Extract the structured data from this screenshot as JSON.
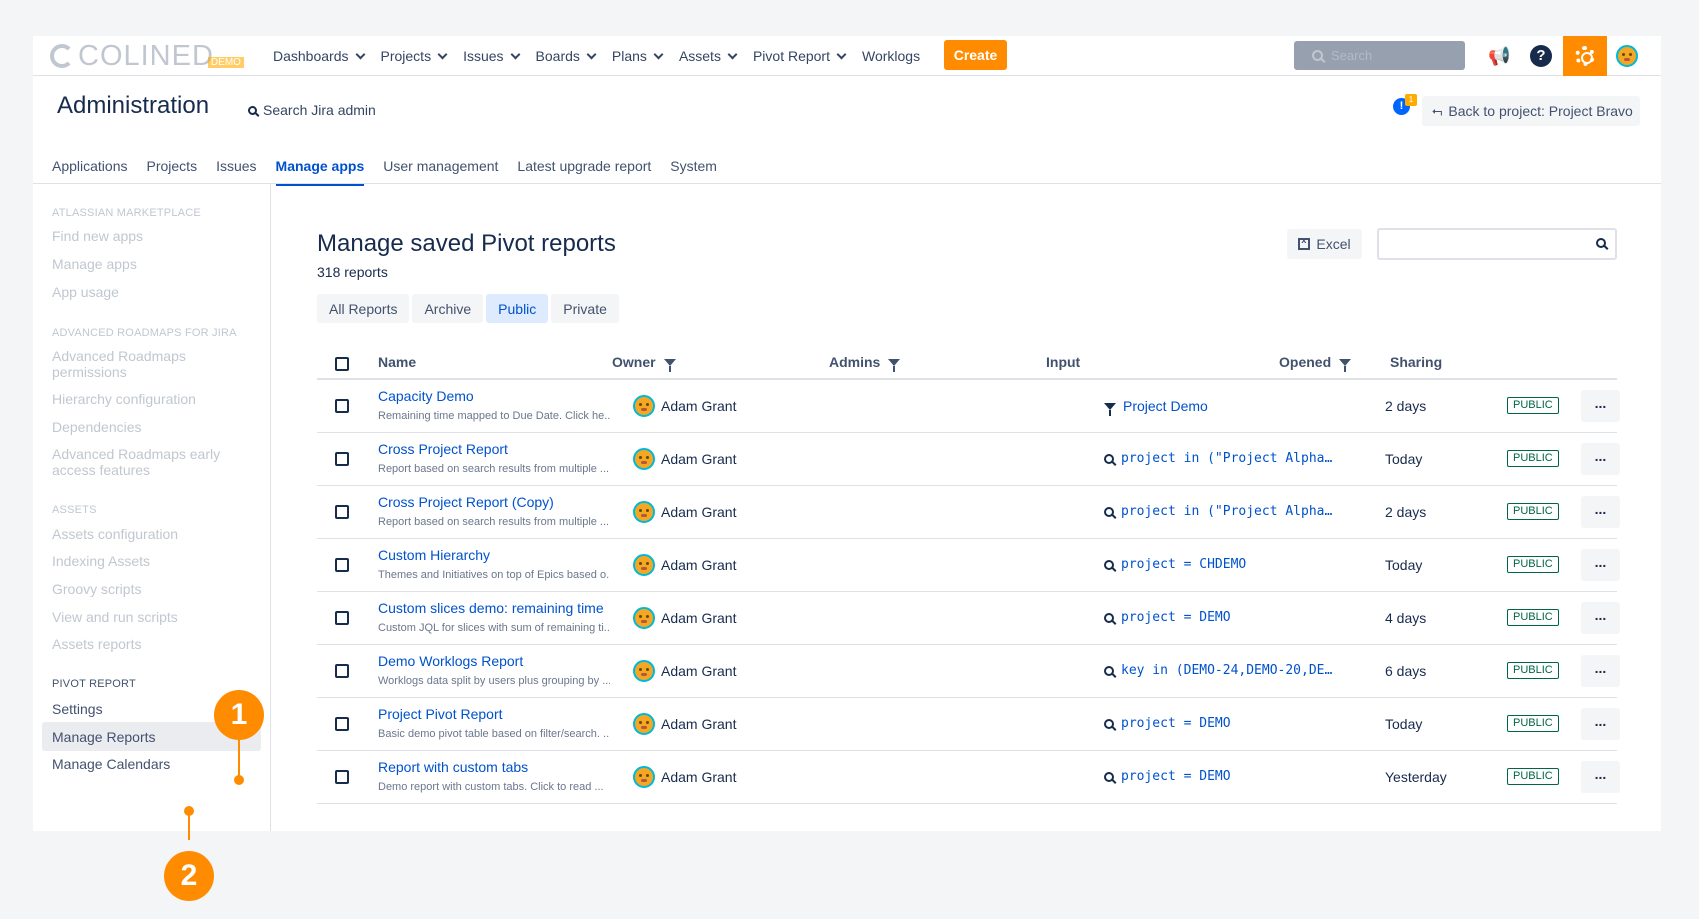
{
  "logo": {
    "text": "COLINED",
    "badge": "DEMO"
  },
  "topnav": {
    "items": [
      {
        "label": "Dashboards",
        "dropdown": true
      },
      {
        "label": "Projects",
        "dropdown": true
      },
      {
        "label": "Issues",
        "dropdown": true
      },
      {
        "label": "Boards",
        "dropdown": true
      },
      {
        "label": "Plans",
        "dropdown": true
      },
      {
        "label": "Assets",
        "dropdown": true
      },
      {
        "label": "Pivot Report",
        "dropdown": true
      },
      {
        "label": "Worklogs",
        "dropdown": false
      }
    ],
    "create_label": "Create",
    "search_placeholder": "Search",
    "help_glyph": "?",
    "megaphone_glyph": "📢"
  },
  "admin": {
    "title": "Administration",
    "search_label": "Search Jira admin",
    "notif_glyph": "!",
    "notif_count": "1",
    "back_label": "Back to project: Project Bravo"
  },
  "admin_tabs": [
    {
      "label": "Applications",
      "active": false
    },
    {
      "label": "Projects",
      "active": false
    },
    {
      "label": "Issues",
      "active": false
    },
    {
      "label": "Manage apps",
      "active": true
    },
    {
      "label": "User management",
      "active": false
    },
    {
      "label": "Latest upgrade report",
      "active": false
    },
    {
      "label": "System",
      "active": false
    }
  ],
  "sidebar": {
    "sections": [
      {
        "title": "ATLASSIAN MARKETPLACE",
        "items": [
          "Find new apps",
          "Manage apps",
          "App usage"
        ]
      },
      {
        "title": "ADVANCED ROADMAPS FOR JIRA",
        "items": [
          "Advanced Roadmaps permissions",
          "Hierarchy configuration",
          "Dependencies",
          "Advanced Roadmaps early access features"
        ]
      },
      {
        "title": "ASSETS",
        "items": [
          "Assets configuration",
          "Indexing Assets",
          "Groovy scripts",
          "View and run scripts",
          "Assets reports"
        ]
      },
      {
        "title": "PIVOT REPORT",
        "items": [
          "Settings",
          "Manage Reports",
          "Manage Calendars"
        ]
      }
    ]
  },
  "main": {
    "title": "Manage saved Pivot reports",
    "count": "318 reports",
    "excel_label": "Excel",
    "filter_tabs": [
      {
        "label": "All Reports",
        "active": false
      },
      {
        "label": "Archive",
        "active": false
      },
      {
        "label": "Public",
        "active": true
      },
      {
        "label": "Private",
        "active": false
      }
    ],
    "columns": {
      "name": "Name",
      "owner": "Owner",
      "admins": "Admins",
      "input": "Input",
      "opened": "Opened",
      "sharing": "Sharing"
    },
    "rows": [
      {
        "name": "Capacity Demo",
        "desc": "Remaining time mapped to Due Date. Click he...",
        "owner": "Adam Grant",
        "input_type": "filter",
        "input": "Project Demo",
        "opened": "2 days",
        "sharing": "PUBLIC"
      },
      {
        "name": "Cross Project Report",
        "desc": "Report based on search results from multiple ...",
        "owner": "Adam Grant",
        "input_type": "jql",
        "input": "project in (\"Project Alpha…",
        "opened": "Today",
        "sharing": "PUBLIC"
      },
      {
        "name": "Cross Project Report (Copy)",
        "desc": "Report based on search results from multiple ...",
        "owner": "Adam Grant",
        "input_type": "jql",
        "input": "project in (\"Project Alpha…",
        "opened": "2 days",
        "sharing": "PUBLIC"
      },
      {
        "name": "Custom Hierarchy",
        "desc": "Themes and Initiatives on top of Epics based o...",
        "owner": "Adam Grant",
        "input_type": "jql",
        "input": "project = CHDEMO",
        "opened": "Today",
        "sharing": "PUBLIC"
      },
      {
        "name": "Custom slices demo: remaining time",
        "desc": "Custom JQL for slices with sum of remaining ti...",
        "owner": "Adam Grant",
        "input_type": "jql",
        "input": "project = DEMO",
        "opened": "4 days",
        "sharing": "PUBLIC"
      },
      {
        "name": "Demo Worklogs Report",
        "desc": "Worklogs data split by users plus grouping by ...",
        "owner": "Adam Grant",
        "input_type": "jql",
        "input": "key in (DEMO-24,DEMO-20,DE…",
        "opened": "6 days",
        "sharing": "PUBLIC"
      },
      {
        "name": "Project Pivot Report",
        "desc": "Basic demo pivot table based on filter/search. ...",
        "owner": "Adam Grant",
        "input_type": "jql",
        "input": "project = DEMO",
        "opened": "Today",
        "sharing": "PUBLIC"
      },
      {
        "name": "Report with custom tabs",
        "desc": "Demo report with custom tabs. Click to read ...",
        "owner": "Adam Grant",
        "input_type": "jql",
        "input": "project = DEMO",
        "opened": "Yesterday",
        "sharing": "PUBLIC"
      }
    ],
    "more_label": "..."
  },
  "callouts": [
    "1",
    "2"
  ],
  "colors": {
    "accent": "#ff8b00",
    "link": "#0052cc",
    "public": "#006644"
  }
}
